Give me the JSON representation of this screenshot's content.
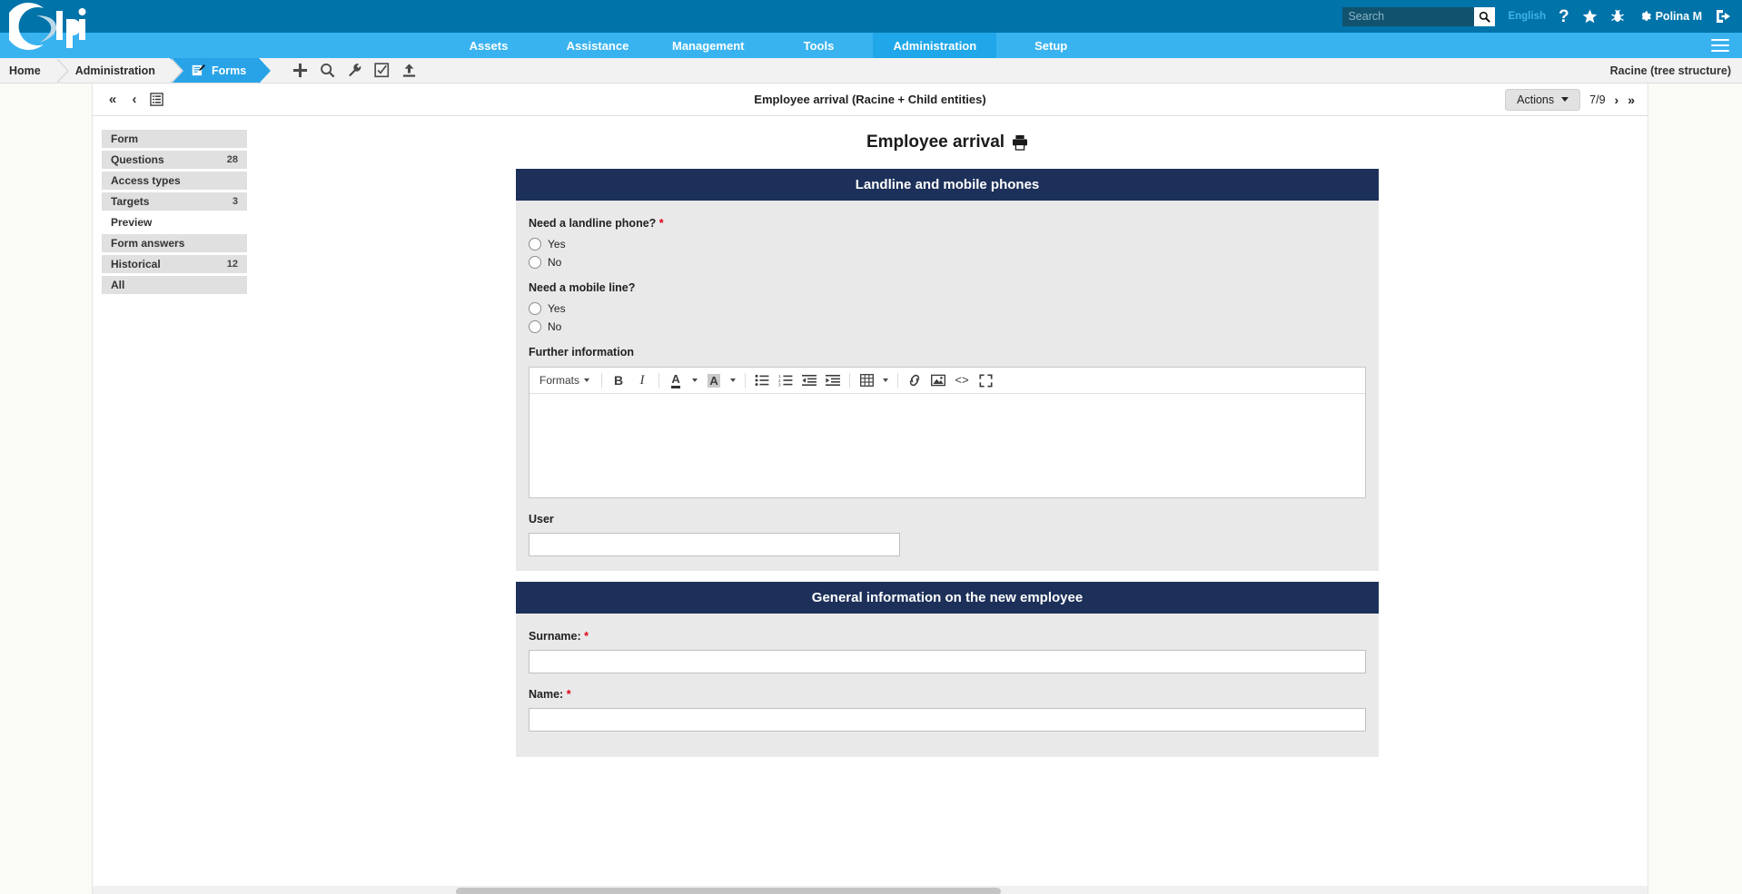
{
  "topbar": {
    "search_placeholder": "Search",
    "search_value": "",
    "language": "English",
    "help_icon": "help-icon",
    "favorites_icon": "star-icon",
    "bug_icon": "bug-icon",
    "settings_icon": "gear-icon",
    "username": "Polina M",
    "logout_icon": "logout-icon",
    "logo_text": "Glpi"
  },
  "mainmenu": {
    "items": [
      {
        "label": "Assets",
        "active": false
      },
      {
        "label": "Assistance",
        "active": false
      },
      {
        "label": "Management",
        "active": false
      },
      {
        "label": "Tools",
        "active": false
      },
      {
        "label": "Administration",
        "active": true
      },
      {
        "label": "Setup",
        "active": false
      }
    ],
    "hamburger_icon": "menu-icon"
  },
  "breadcrumb": {
    "items": [
      {
        "label": "Home"
      },
      {
        "label": "Administration"
      },
      {
        "label": "Forms",
        "current": true,
        "icon": "form-edit-icon"
      }
    ],
    "icons": [
      {
        "name": "add-icon",
        "glyph": "+"
      },
      {
        "name": "search-icon",
        "glyph": "search"
      },
      {
        "name": "wrench-icon",
        "glyph": "wrench"
      },
      {
        "name": "checkbox-icon",
        "glyph": "checkbox"
      },
      {
        "name": "upload-icon",
        "glyph": "upload"
      }
    ],
    "entity": "Racine (tree structure)"
  },
  "sheet_header": {
    "title": "Employee arrival (Racine + Child entities)",
    "nav_first_icon": "first-page-icon",
    "nav_prev_icon": "previous-page-icon",
    "list_icon": "list-view-icon",
    "actions_label": "Actions",
    "page_indicator": "7/9",
    "nav_next_icon": "next-page-icon",
    "nav_last_icon": "last-page-icon"
  },
  "sidebar": {
    "items": [
      {
        "label": "Form",
        "badge": "",
        "active": false
      },
      {
        "label": "Questions",
        "badge": "28",
        "active": false
      },
      {
        "label": "Access types",
        "badge": "",
        "active": false
      },
      {
        "label": "Targets",
        "badge": "3",
        "active": false
      },
      {
        "label": "Preview",
        "badge": "",
        "active": true
      },
      {
        "label": "Form answers",
        "badge": "",
        "active": false
      },
      {
        "label": "Historical",
        "badge": "12",
        "active": false
      },
      {
        "label": "All",
        "badge": "",
        "active": false
      }
    ]
  },
  "form": {
    "title": "Employee arrival",
    "print_icon": "print-icon",
    "sections": [
      {
        "header": "Landline and mobile phones",
        "questions": [
          {
            "label": "Need a landline phone?",
            "required": true,
            "type": "radio",
            "options": [
              "Yes",
              "No"
            ]
          },
          {
            "label": "Need a mobile line?",
            "required": false,
            "type": "radio",
            "options": [
              "Yes",
              "No"
            ]
          },
          {
            "label": "Further information",
            "required": false,
            "type": "richtext",
            "value": ""
          },
          {
            "label": "User",
            "required": false,
            "type": "text-short",
            "value": ""
          }
        ]
      },
      {
        "header": "General information on the new employee",
        "questions": [
          {
            "label": "Surname:",
            "required": true,
            "type": "text",
            "value": ""
          },
          {
            "label": "Name:",
            "required": true,
            "type": "text",
            "value": ""
          }
        ]
      }
    ]
  },
  "editor_toolbar": {
    "formats_label": "Formats",
    "buttons": [
      {
        "name": "bold-icon",
        "label": "B"
      },
      {
        "name": "italic-icon",
        "label": "I"
      },
      {
        "name": "text-color-icon",
        "label": "A"
      },
      {
        "name": "background-color-icon",
        "label": "A"
      },
      {
        "name": "bullet-list-icon",
        "label": ""
      },
      {
        "name": "numbered-list-icon",
        "label": ""
      },
      {
        "name": "outdent-icon",
        "label": ""
      },
      {
        "name": "indent-icon",
        "label": ""
      },
      {
        "name": "table-icon",
        "label": ""
      },
      {
        "name": "link-icon",
        "label": ""
      },
      {
        "name": "image-icon",
        "label": ""
      },
      {
        "name": "source-code-icon",
        "label": "<>"
      },
      {
        "name": "fullscreen-icon",
        "label": ""
      }
    ]
  },
  "colors": {
    "topbar_blue": "#0073a9",
    "menu_blue": "#39b3ef",
    "menu_active": "#1fa7ea",
    "section_navy": "#1c3059",
    "required_red": "#e2001a",
    "section_body_grey": "#e9e9e9"
  }
}
